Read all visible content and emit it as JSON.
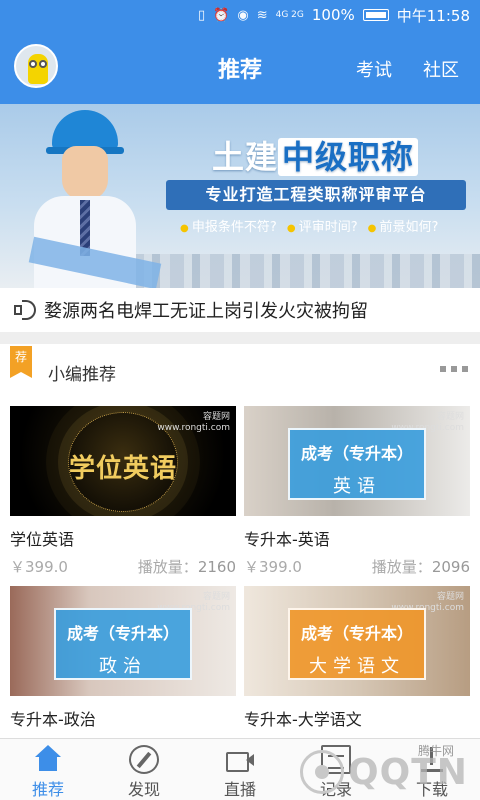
{
  "status_bar": {
    "battery": "100%",
    "time": "中午11:58",
    "signal": "4G 2G"
  },
  "header": {
    "title": "推荐",
    "links": [
      "考试",
      "社区"
    ]
  },
  "banner": {
    "title_plain": "土建",
    "title_highlight": "中级职称",
    "subtitle": "专业打造工程类职称评审平台",
    "tags": [
      "申报条件不符?",
      "评审时间?",
      "前景如何?"
    ]
  },
  "notice": {
    "text": "婺源两名电焊工无证上岗引发火灾被拘留"
  },
  "section": {
    "tag": "荐",
    "title": "小编推荐"
  },
  "courses": [
    {
      "thumb_text": "学位英语",
      "watermark": "容题网\nwww.rongti.com",
      "title": "学位英语",
      "price": "￥399.0",
      "plays_label": "播放量：",
      "plays": "2160"
    },
    {
      "thumb_line1": "成考（专升本）",
      "thumb_line2": "英语",
      "watermark": "容题网\nwww.rongti.com",
      "title": "专升本-英语",
      "price": "￥399.0",
      "plays_label": "播放量：",
      "plays": "2096"
    },
    {
      "thumb_line1": "成考（专升本）",
      "thumb_line2": "政治",
      "watermark": "容题网\nwww.rongti.com",
      "title": "专升本-政治"
    },
    {
      "thumb_line1": "成考（专升本）",
      "thumb_line2": "大学语文",
      "watermark": "容题网\nwww.rongti.com",
      "title": "专升本-大学语文"
    }
  ],
  "tabbar": [
    {
      "label": "推荐",
      "icon": "home-icon",
      "active": true
    },
    {
      "label": "发现",
      "icon": "compass-icon",
      "active": false
    },
    {
      "label": "直播",
      "icon": "video-icon",
      "active": false
    },
    {
      "label": "记录",
      "icon": "note-icon",
      "active": false
    },
    {
      "label": "下载",
      "icon": "download-icon",
      "active": false
    }
  ],
  "site_watermark": {
    "brand": "QQTN",
    "small": "腾牛网"
  },
  "colors": {
    "primary": "#3d8ee8",
    "tag_orange": "#f3a125",
    "thumb_blue": "#349cde",
    "thumb_orange": "#f09628"
  }
}
